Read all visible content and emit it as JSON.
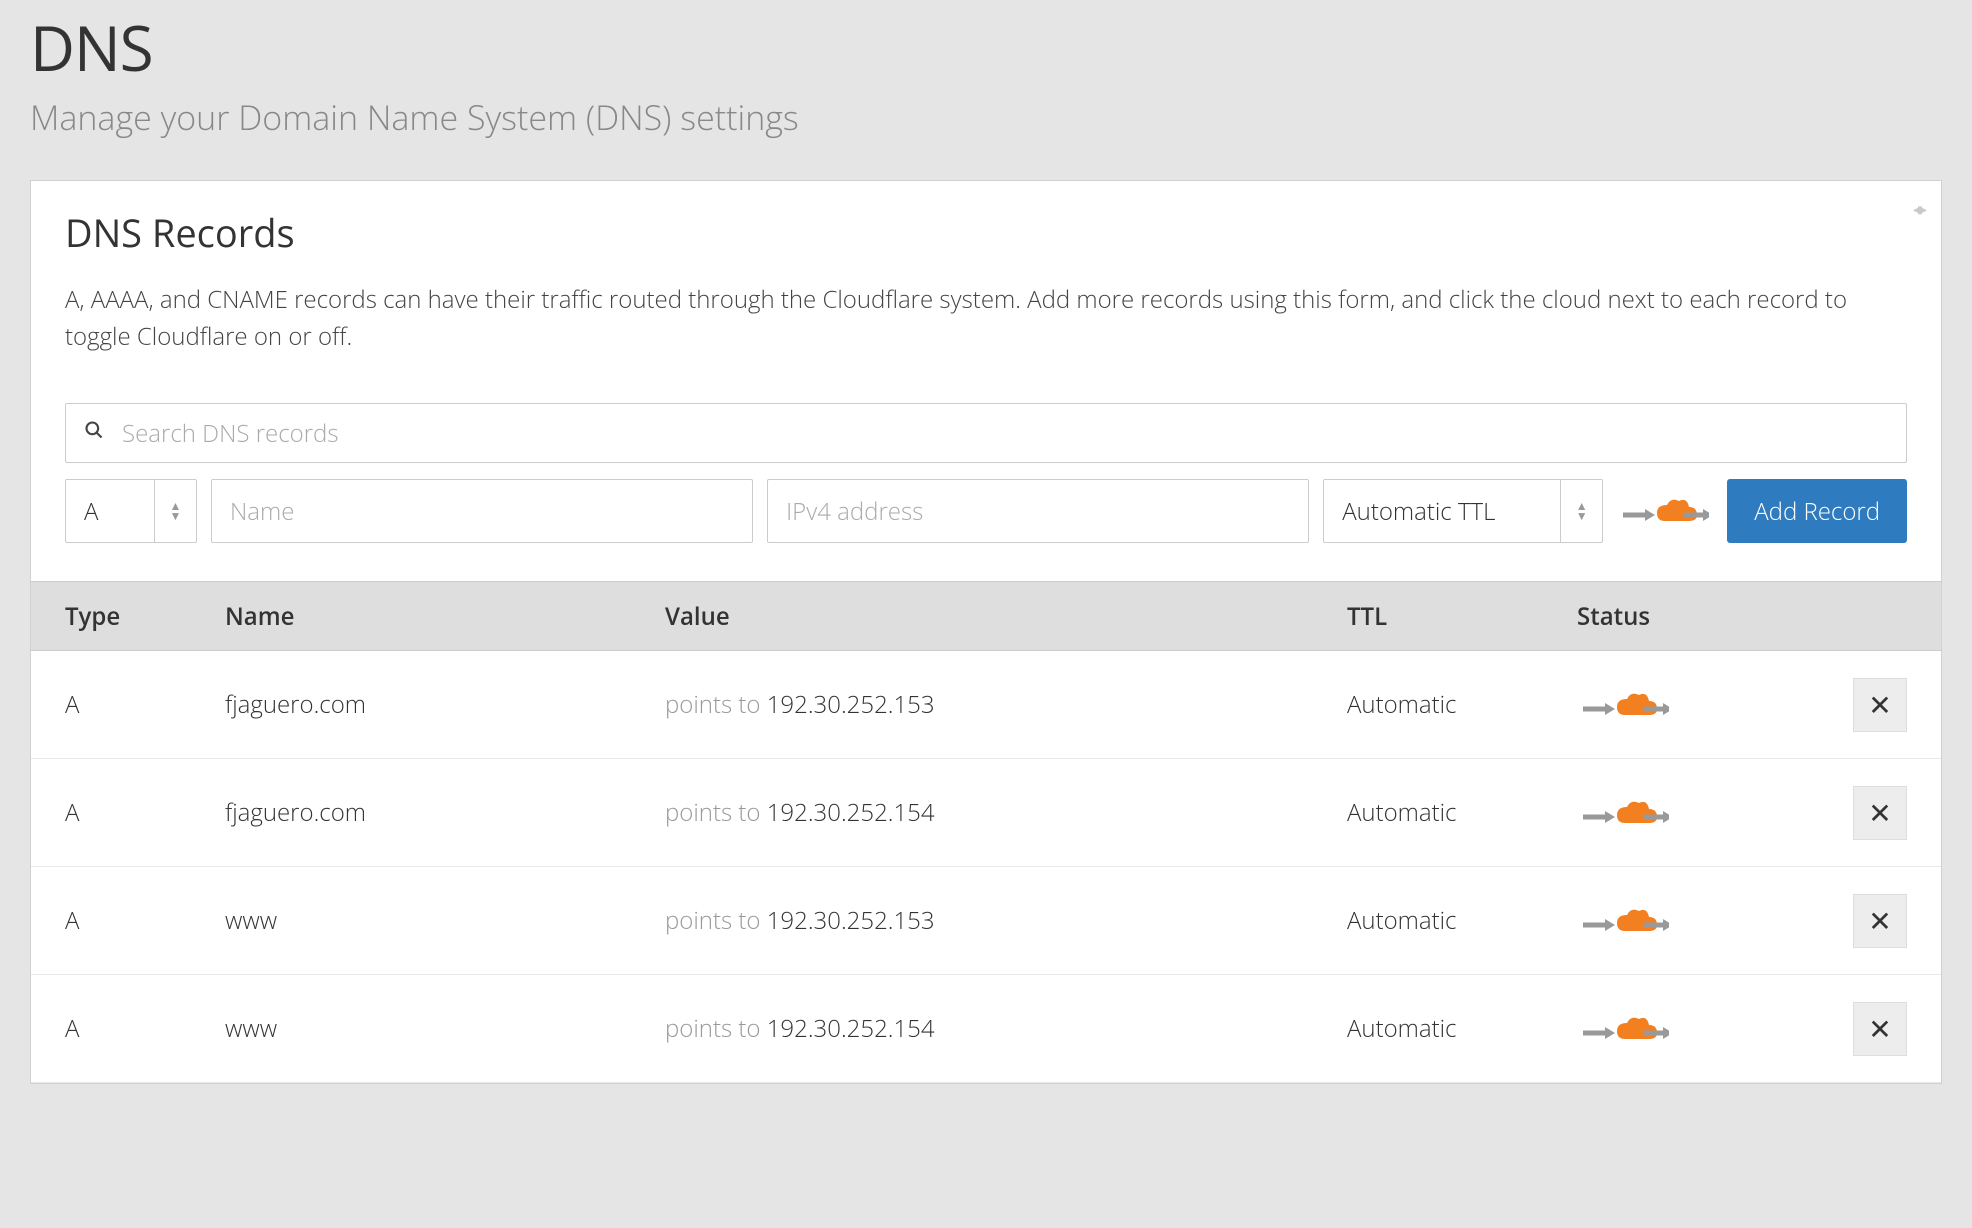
{
  "header": {
    "title": "DNS",
    "subtitle": "Manage your Domain Name System (DNS) settings"
  },
  "card": {
    "title": "DNS Records",
    "description": "A, AAAA, and CNAME records can have their traffic routed through the Cloudflare system. Add more records using this form, and click the cloud next to each record to toggle Cloudflare on or off."
  },
  "search": {
    "placeholder": "Search DNS records"
  },
  "form": {
    "type_value": "A",
    "name_placeholder": "Name",
    "value_placeholder": "IPv4 address",
    "ttl_value": "Automatic TTL",
    "add_button": "Add Record"
  },
  "table": {
    "columns": {
      "type": "Type",
      "name": "Name",
      "value": "Value",
      "ttl": "TTL",
      "status": "Status"
    },
    "value_prefix": "points to ",
    "rows": [
      {
        "type": "A",
        "name": "fjaguero.com",
        "value": "192.30.252.153",
        "ttl": "Automatic",
        "proxied": true
      },
      {
        "type": "A",
        "name": "fjaguero.com",
        "value": "192.30.252.154",
        "ttl": "Automatic",
        "proxied": true
      },
      {
        "type": "A",
        "name": "www",
        "value": "192.30.252.153",
        "ttl": "Automatic",
        "proxied": true
      },
      {
        "type": "A",
        "name": "www",
        "value": "192.30.252.154",
        "ttl": "Automatic",
        "proxied": true
      }
    ]
  }
}
